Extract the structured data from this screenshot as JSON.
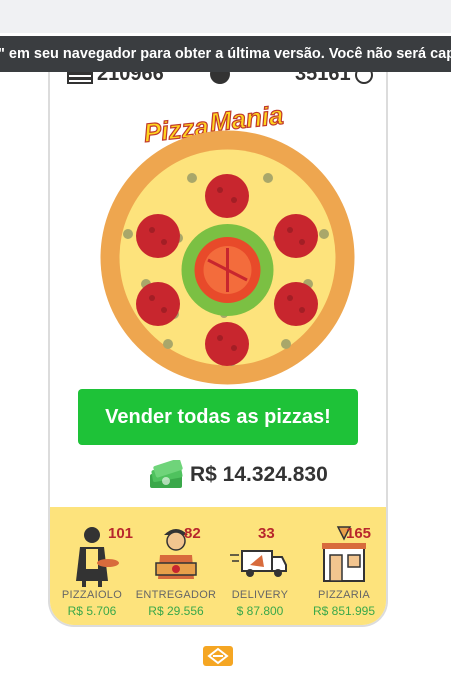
{
  "notice": {
    "text": "\" em seu navegador para obter a última versão. Você não será capa"
  },
  "stats": {
    "pizzas": "210966",
    "timer": "35161"
  },
  "logo": {
    "word1": "Pizza",
    "word2": "Mania"
  },
  "sell_button": {
    "label": "Vender todas as pizzas!"
  },
  "money": {
    "amount": "R$ 14.324.830"
  },
  "staff": [
    {
      "name": "PIZZAIOLO",
      "count": "101",
      "price": "R$ 5.706"
    },
    {
      "name": "ENTREGADOR",
      "count": "82",
      "price": "R$ 29.556"
    },
    {
      "name": "DELIVERY",
      "count": "33",
      "price": "$ 87.800"
    },
    {
      "name": "PIZZARIA",
      "count": "165",
      "price": "R$ 851.995"
    }
  ],
  "colors": {
    "accent_green": "#1ec238",
    "count_red": "#b8272c",
    "price_green": "#3aa84a",
    "staff_bg": "#fde37c"
  }
}
